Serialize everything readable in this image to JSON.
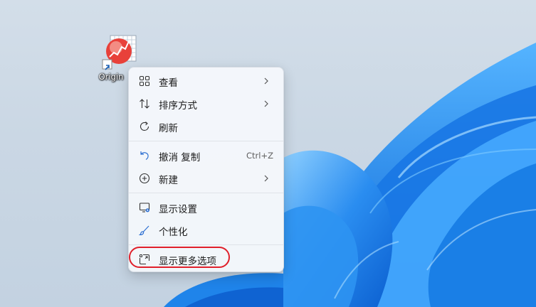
{
  "desktop": {
    "icons": [
      {
        "label": "Origin",
        "icon": "origin-app-icon",
        "shortcut_overlay": "shortcut-arrow-icon"
      }
    ]
  },
  "context_menu": {
    "items": [
      {
        "label": "查看",
        "icon": "grid-view-icon",
        "has_submenu": true
      },
      {
        "label": "排序方式",
        "icon": "sort-arrows-icon",
        "has_submenu": true
      },
      {
        "label": "刷新",
        "icon": "refresh-icon",
        "has_submenu": false
      },
      {
        "label": "撤消 复制",
        "icon": "undo-icon",
        "shortcut": "Ctrl+Z"
      },
      {
        "label": "新建",
        "icon": "add-circle-icon",
        "has_submenu": true
      },
      {
        "label": "显示设置",
        "icon": "display-settings-icon"
      },
      {
        "label": "个性化",
        "icon": "brush-icon"
      },
      {
        "label": "显示更多选项",
        "icon": "show-more-options-icon",
        "highlighted": true
      }
    ]
  },
  "colors": {
    "wallpaper_bg": "#cfdbe7",
    "bloom_blue": "#1a7fe6",
    "highlight_ring": "#e01f2a",
    "menu_bg": "#f4f7fb"
  }
}
